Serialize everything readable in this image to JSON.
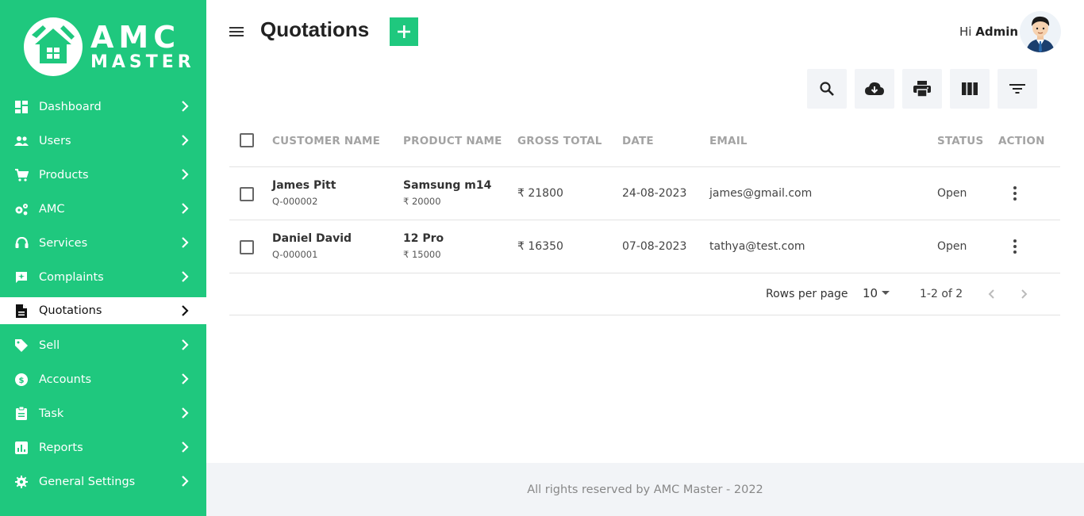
{
  "brand": {
    "line1": "AMC",
    "line2": "MASTER",
    "color": "#1fc87e"
  },
  "sidebar": {
    "items": [
      {
        "label": "Dashboard",
        "icon": "dashboard-icon"
      },
      {
        "label": "Users",
        "icon": "users-icon"
      },
      {
        "label": "Products",
        "icon": "cart-icon"
      },
      {
        "label": "AMC",
        "icon": "gears-icon"
      },
      {
        "label": "Services",
        "icon": "support-icon"
      },
      {
        "label": "Complaints",
        "icon": "feedback-icon"
      },
      {
        "label": "Quotations",
        "icon": "document-icon",
        "active": true
      },
      {
        "label": "Sell",
        "icon": "tag-icon"
      },
      {
        "label": "Accounts",
        "icon": "dollar-icon"
      },
      {
        "label": "Task",
        "icon": "clipboard-icon"
      },
      {
        "label": "Reports",
        "icon": "report-icon"
      },
      {
        "label": "General Settings",
        "icon": "gear-icon"
      }
    ]
  },
  "header": {
    "title": "Quotations",
    "greeting_prefix": "Hi",
    "user_name": "Admin"
  },
  "toolbar": [
    "search-icon",
    "download-icon",
    "print-icon",
    "columns-icon",
    "filter-icon"
  ],
  "table": {
    "headers": [
      "CUSTOMER NAME",
      "PRODUCT NAME",
      "GROSS TOTAL",
      "DATE",
      "EMAIL",
      "STATUS",
      "ACTION"
    ],
    "rows": [
      {
        "customer": "James Pitt",
        "quote_id": "Q-000002",
        "product": "Samsung m14",
        "product_price": "₹ 20000",
        "gross_total": "₹ 21800",
        "date": "24-08-2023",
        "email": "james@gmail.com",
        "status": "Open"
      },
      {
        "customer": "Daniel David",
        "quote_id": "Q-000001",
        "product": "12 Pro",
        "product_price": "₹ 15000",
        "gross_total": "₹ 16350",
        "date": "07-08-2023",
        "email": "tathya@test.com",
        "status": "Open"
      }
    ]
  },
  "pagination": {
    "rows_per_page_label": "Rows per page",
    "rows_per_page": "10",
    "range": "1-2 of 2"
  },
  "footer": {
    "text": "All rights reserved by AMC Master - 2022"
  }
}
